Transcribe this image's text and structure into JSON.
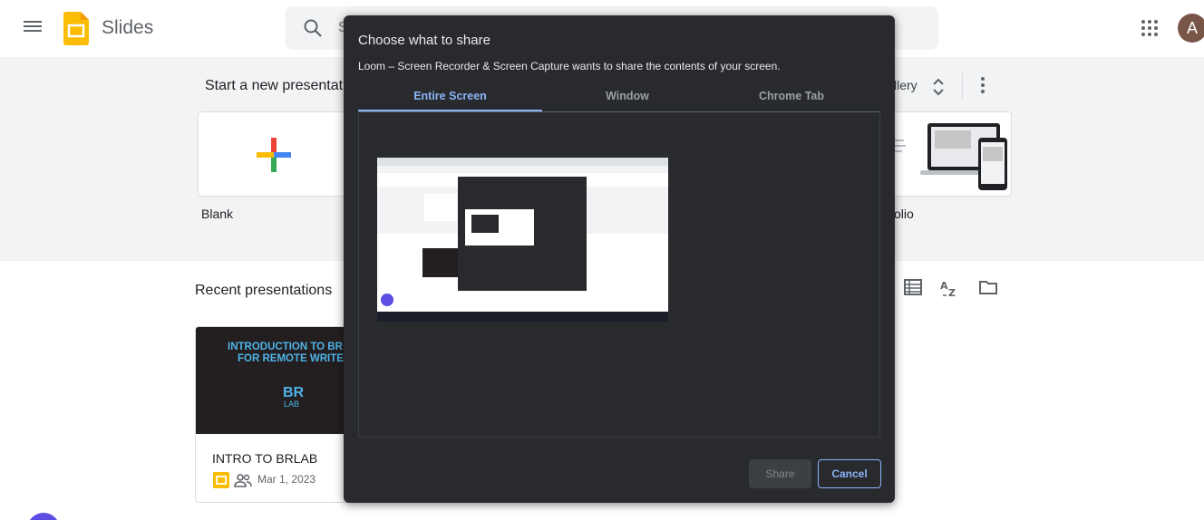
{
  "header": {
    "app_name": "Slides",
    "search_placeholder": "S"
  },
  "user": {
    "avatar_initial": "A"
  },
  "templates": {
    "title": "Start a new presentation",
    "gallery_label": "llery",
    "blank_label": "Blank",
    "portfolio_label": "olio"
  },
  "recent": {
    "title": "Recent presentations",
    "documents": [
      {
        "thumb_line1": "INTRODUCTION TO BR L",
        "thumb_line2": "FOR REMOTE WRITER",
        "thumb_logo_top": "BR",
        "thumb_logo_bottom": "LAB",
        "name": "INTRO TO BRLAB",
        "date": "Mar 1, 2023"
      }
    ]
  },
  "dialog": {
    "title": "Choose what to share",
    "subtitle": "Loom – Screen Recorder & Screen Capture wants to share the contents of your screen.",
    "tabs": [
      {
        "label": "Entire Screen",
        "active": true
      },
      {
        "label": "Window",
        "active": false
      },
      {
        "label": "Chrome Tab",
        "active": false
      }
    ],
    "share_label": "Share",
    "cancel_label": "Cancel"
  },
  "colors": {
    "accent_blue": "#8ab4f8",
    "dialog_bg": "#292a2d",
    "band_bg": "#f1f3f4",
    "slides_yellow": "#fbbc04",
    "avatar_bg": "#795548",
    "thumb_text": "#4fb3e8"
  }
}
